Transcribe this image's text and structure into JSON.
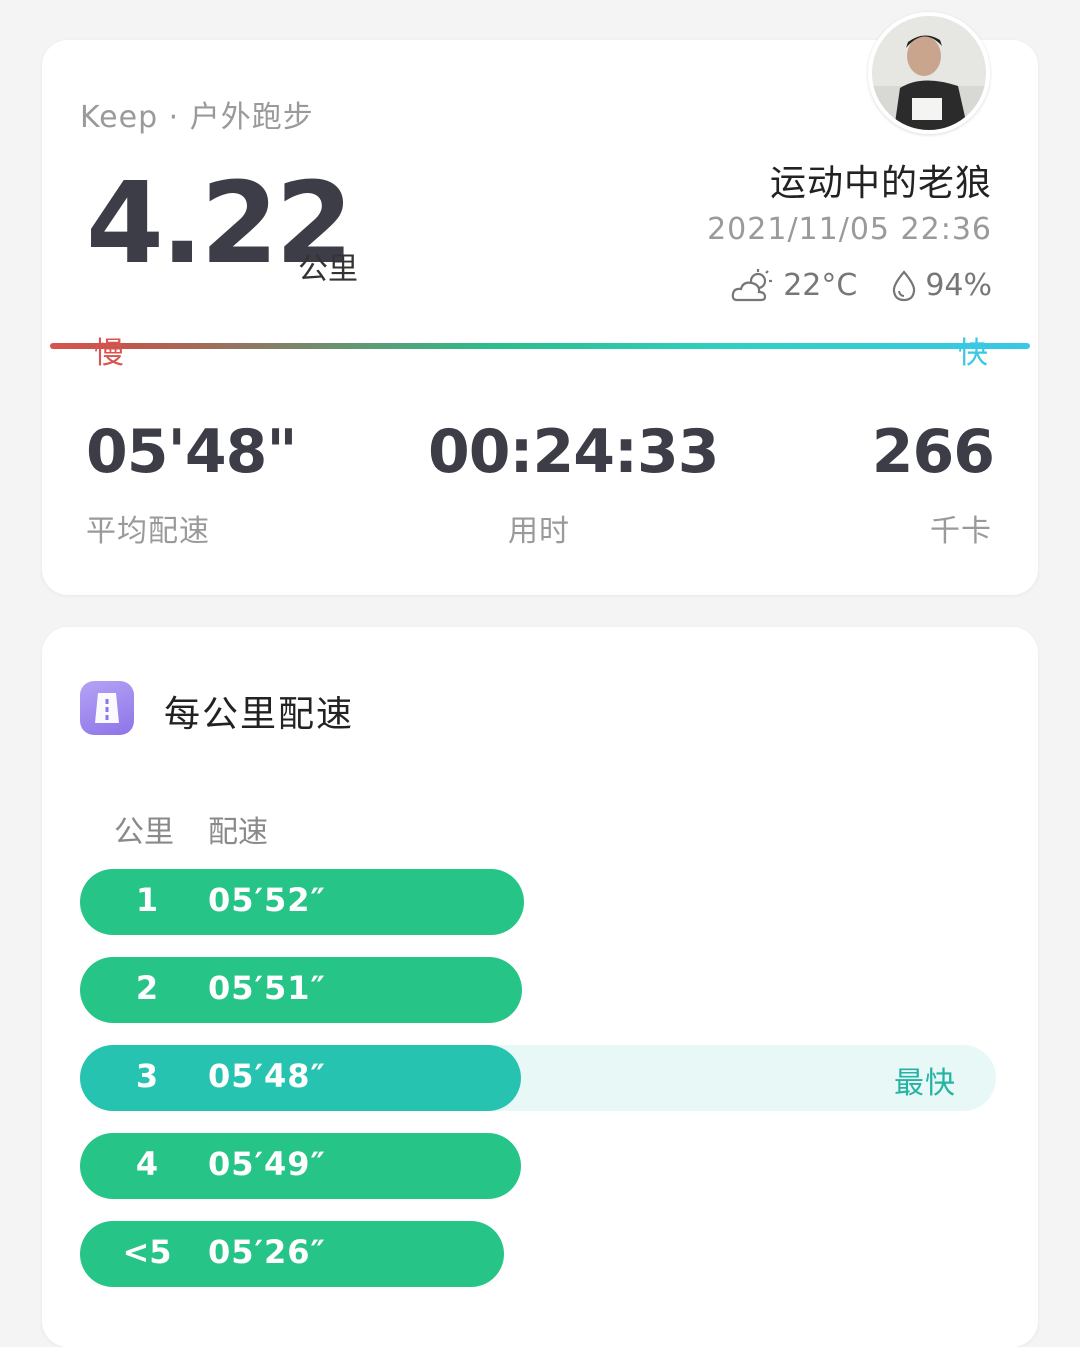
{
  "summary": {
    "source": "Keep · 户外跑步",
    "distance": "4.22",
    "distance_unit": "公里",
    "user_name": "运动中的老狼",
    "datetime": "2021/11/05 22:36",
    "temperature": "22°C",
    "humidity": "94%",
    "slow_label": "慢",
    "fast_label": "快",
    "stats": {
      "avg_pace": {
        "value": "05'48\"",
        "label": "平均配速"
      },
      "duration": {
        "value": "00:24:33",
        "label": "用时"
      },
      "calories": {
        "value": "266",
        "label": "千卡"
      }
    }
  },
  "pace_section": {
    "title": "每公里配速",
    "col_km": "公里",
    "col_pace": "配速",
    "fastest_label": "最快",
    "rows": [
      {
        "km": "1",
        "pace": "05′52″",
        "fraction": 0.485
      },
      {
        "km": "2",
        "pace": "05′51″",
        "fraction": 0.483
      },
      {
        "km": "3",
        "pace": "05′48″",
        "fraction": 0.481
      },
      {
        "km": "4",
        "pace": "05′49″",
        "fraction": 0.481
      },
      {
        "km": "<5",
        "pace": "05′26″",
        "fraction": 0.463
      }
    ]
  },
  "colors": {
    "accent_green": "#27c487",
    "fastest_teal": "#26c4b0",
    "slow_red": "#d9534f",
    "fast_cyan": "#39c8e6"
  },
  "icons": [
    "cloud-sun-icon",
    "drop-icon",
    "pace-icon",
    "avatar"
  ]
}
